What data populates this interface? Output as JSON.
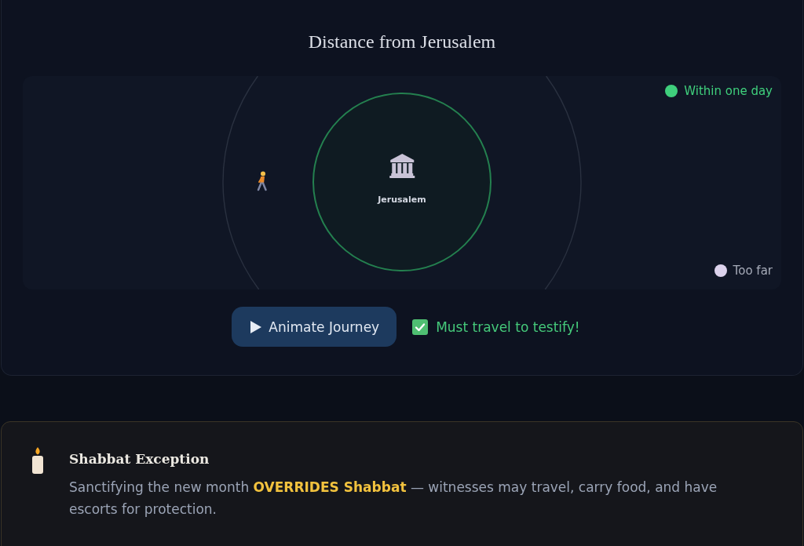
{
  "panel": {
    "title": "Distance from Jerusalem"
  },
  "map": {
    "center_label": "Jerusalem",
    "legend": [
      {
        "label": "Within one day",
        "color": "#3fcf7c",
        "active": true
      },
      {
        "label": "Too far",
        "color": "#dcd2ec",
        "active": false
      }
    ]
  },
  "controls": {
    "animate_button": {
      "label": "Animate Journey"
    },
    "checkbox": {
      "label": "Must travel to testify!",
      "checked": true
    }
  },
  "note": {
    "title": "Shabbat Exception",
    "text": "Sanctifying the new month **OVERRIDES Shabbat** — witnesses may travel, carry food, and have escorts for protection."
  }
}
